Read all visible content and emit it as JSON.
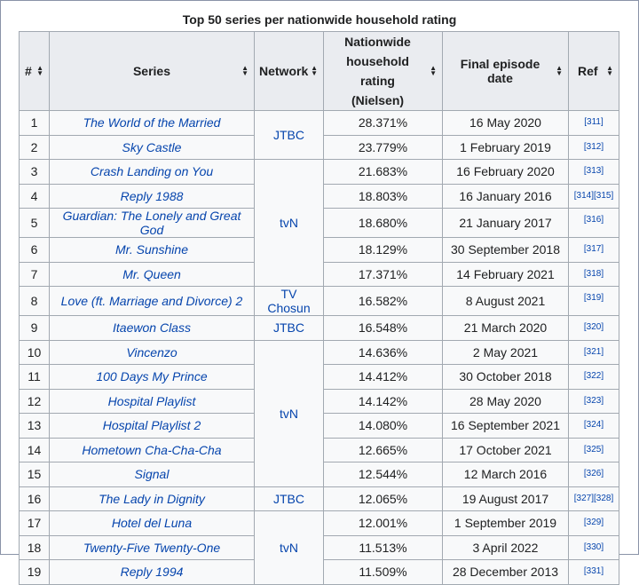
{
  "caption": "Top 50 series per nationwide household rating",
  "headers": {
    "rank": "#",
    "series": "Series",
    "network": "Network",
    "rating_line1": "Nationwide",
    "rating_line2": "household rating",
    "rating_line3": "(Nielsen)",
    "final": "Final episode date",
    "ref": "Ref"
  },
  "rows": [
    {
      "rank": "1",
      "series": "The World of the Married",
      "rating": "28.371%",
      "date": "16 May 2020",
      "ref": "[311]"
    },
    {
      "rank": "2",
      "series": "Sky Castle",
      "rating": "23.779%",
      "date": "1 February 2019",
      "ref": "[312]"
    },
    {
      "rank": "3",
      "series": "Crash Landing on You",
      "rating": "21.683%",
      "date": "16 February 2020",
      "ref": "[313]"
    },
    {
      "rank": "4",
      "series": "Reply 1988",
      "rating": "18.803%",
      "date": "16 January 2016",
      "ref": "[314][315]"
    },
    {
      "rank": "5",
      "series": "Guardian: The Lonely and Great God",
      "rating": "18.680%",
      "date": "21 January 2017",
      "ref": "[316]"
    },
    {
      "rank": "6",
      "series": "Mr. Sunshine",
      "rating": "18.129%",
      "date": "30 September 2018",
      "ref": "[317]"
    },
    {
      "rank": "7",
      "series": "Mr. Queen",
      "rating": "17.371%",
      "date": "14 February 2021",
      "ref": "[318]"
    },
    {
      "rank": "8",
      "series": "Love (ft. Marriage and Divorce) 2",
      "rating": "16.582%",
      "date": "8 August 2021",
      "ref": "[319]"
    },
    {
      "rank": "9",
      "series": "Itaewon Class",
      "rating": "16.548%",
      "date": "21 March 2020",
      "ref": "[320]"
    },
    {
      "rank": "10",
      "series": "Vincenzo",
      "rating": "14.636%",
      "date": "2 May 2021",
      "ref": "[321]"
    },
    {
      "rank": "11",
      "series": "100 Days My Prince",
      "rating": "14.412%",
      "date": "30 October 2018",
      "ref": "[322]"
    },
    {
      "rank": "12",
      "series": "Hospital Playlist",
      "rating": "14.142%",
      "date": "28 May 2020",
      "ref": "[323]"
    },
    {
      "rank": "13",
      "series": "Hospital Playlist 2",
      "rating": "14.080%",
      "date": "16 September 2021",
      "ref": "[324]"
    },
    {
      "rank": "14",
      "series": "Hometown Cha-Cha-Cha",
      "rating": "12.665%",
      "date": "17 October 2021",
      "ref": "[325]"
    },
    {
      "rank": "15",
      "series": "Signal",
      "rating": "12.544%",
      "date": "12 March 2016",
      "ref": "[326]"
    },
    {
      "rank": "16",
      "series": "The Lady in Dignity",
      "rating": "12.065%",
      "date": "19 August 2017",
      "ref": "[327][328]"
    },
    {
      "rank": "17",
      "series": "Hotel del Luna",
      "rating": "12.001%",
      "date": "1 September 2019",
      "ref": "[329]"
    },
    {
      "rank": "18",
      "series": "Twenty-Five Twenty-One",
      "rating": "11.513%",
      "date": "3 April 2022",
      "ref": "[330]"
    },
    {
      "rank": "19",
      "series": "Reply 1994",
      "rating": "11.509%",
      "date": "28 December 2013",
      "ref": "[331]"
    }
  ],
  "networks": {
    "n1": "JTBC",
    "n2": "tvN",
    "n3": "TV Chosun",
    "n4": "JTBC",
    "n5": "tvN",
    "n6": "JTBC",
    "n7": "tvN"
  }
}
